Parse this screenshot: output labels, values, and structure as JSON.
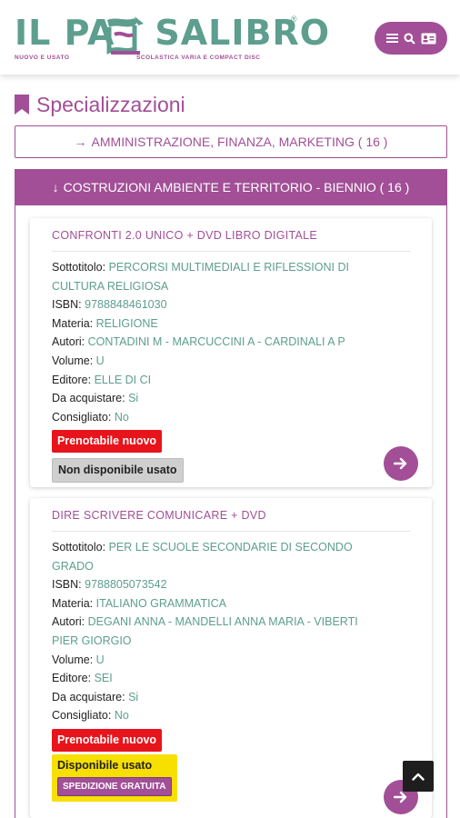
{
  "brand": {
    "logo_left": "IL PA",
    "logo_right": "SALIBRO",
    "registered": "®",
    "tagline_left": "NUOVO E USATO",
    "tagline_right": "SCOLASTICA VARIA E COMPACT DISC",
    "accent": "#a24f97",
    "green": "#5d9e8e"
  },
  "header_menu": {
    "icons": [
      "hamburger-icon",
      "search-icon",
      "id-card-icon"
    ]
  },
  "section": {
    "title": "Specializzazioni",
    "icon": "bookmark-icon"
  },
  "categories": [
    {
      "label": "AMMINISTRAZIONE, FINANZA, MARKETING ( 16 )",
      "arrow": "→",
      "expanded": false
    },
    {
      "label": "COSTRUZIONI AMBIENTE E TERRITORIO - BIENNIO ( 16 )",
      "arrow": "↓",
      "expanded": true
    }
  ],
  "labels": {
    "subtitle": "Sottotitolo:",
    "isbn": "ISBN:",
    "subject": "Materia:",
    "authors": "Autori:",
    "volume": "Volume:",
    "publisher": "Editore:",
    "to_buy": "Da acquistare:",
    "recommended": "Consigliato:"
  },
  "books": [
    {
      "title": "CONFRONTI 2.0 UNICO + DVD LIBRO DIGITALE",
      "subtitle": "PERCORSI MULTIMEDIALI E RIFLESSIONI DI CULTURA RELIGIOSA",
      "isbn": "9788848461030",
      "subject": "RELIGIONE",
      "authors": "CONTADINI M - MARCUCCINI A - CARDINALI A P",
      "volume": "U",
      "publisher": "ELLE DI CI",
      "to_buy": "Si",
      "recommended": "No",
      "new_badge": "Prenotabile nuovo",
      "used_badge": "Non disponibile usato"
    },
    {
      "title": "DIRE SCRIVERE COMUNICARE + DVD",
      "subtitle": "PER LE SCUOLE SECONDARIE DI SECONDO GRADO",
      "isbn": "9788805073542",
      "subject": "ITALIANO GRAMMATICA",
      "authors": "DEGANI ANNA - MANDELLI ANNA MARIA - VIBERTI PIER GIORGIO",
      "volume": "U",
      "publisher": "SEI",
      "to_buy": "Si",
      "recommended": "No",
      "new_badge": "Prenotabile nuovo",
      "used_badge": "Disponibile usato",
      "shipping_badge": "SPEDIZIONE GRATUITA"
    }
  ]
}
